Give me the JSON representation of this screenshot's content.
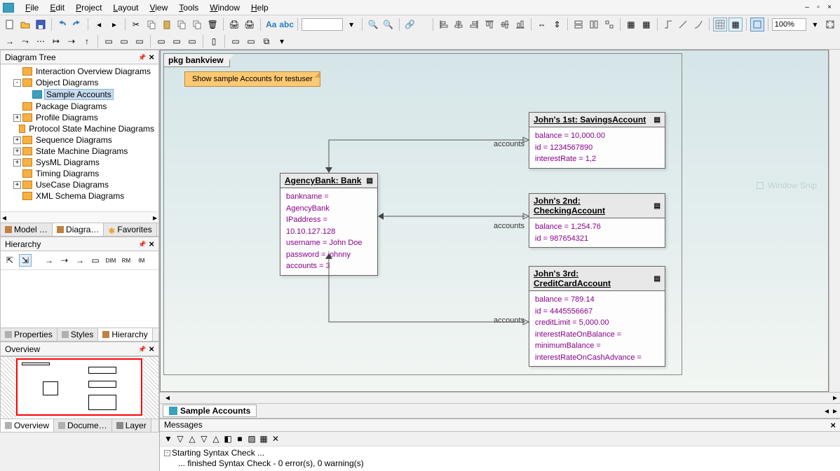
{
  "menu": {
    "items": [
      "File",
      "Edit",
      "Project",
      "Layout",
      "View",
      "Tools",
      "Window",
      "Help"
    ]
  },
  "zoom": "100%",
  "tree": {
    "title": "Diagram Tree",
    "items": [
      {
        "indent": 1,
        "exp": "",
        "label": "Interaction Overview Diagrams"
      },
      {
        "indent": 1,
        "exp": "-",
        "label": "Object Diagrams"
      },
      {
        "indent": 2,
        "exp": "",
        "label": "Sample Accounts",
        "icon": "blue",
        "selected": true
      },
      {
        "indent": 1,
        "exp": "",
        "label": "Package Diagrams"
      },
      {
        "indent": 1,
        "exp": "+",
        "label": "Profile Diagrams"
      },
      {
        "indent": 1,
        "exp": "",
        "label": "Protocol State Machine Diagrams"
      },
      {
        "indent": 1,
        "exp": "+",
        "label": "Sequence Diagrams"
      },
      {
        "indent": 1,
        "exp": "+",
        "label": "State Machine Diagrams"
      },
      {
        "indent": 1,
        "exp": "+",
        "label": "SysML Diagrams"
      },
      {
        "indent": 1,
        "exp": "",
        "label": "Timing Diagrams"
      },
      {
        "indent": 1,
        "exp": "+",
        "label": "UseCase Diagrams"
      },
      {
        "indent": 1,
        "exp": "",
        "label": "XML Schema Diagrams"
      }
    ],
    "tabs": [
      "Model …",
      "Diagra…",
      "Favorites"
    ]
  },
  "hierarchy": {
    "title": "Hierarchy",
    "tabs": [
      "Properties",
      "Styles",
      "Hierarchy"
    ]
  },
  "overview": {
    "title": "Overview",
    "tabs": [
      "Overview",
      "Docume…",
      "Layer"
    ]
  },
  "canvas": {
    "frameLabel": "pkg bankview",
    "note": "Show sample Accounts for testuser",
    "bank": {
      "title": "AgencyBank: Bank",
      "attrs": [
        "bankname =  AgencyBank",
        "IPaddress =  10.10.127.128",
        "username =  John Doe",
        "password =  johnny",
        "accounts =  3"
      ]
    },
    "savings": {
      "title": "John's 1st: SavingsAccount",
      "attrs": [
        "balance =  10,000.00",
        "id =  1234567890",
        "interestRate =  1,2"
      ]
    },
    "checking": {
      "title": "John's 2nd: CheckingAccount",
      "attrs": [
        "balance =  1,254.76",
        "id =  987654321"
      ]
    },
    "credit": {
      "title": "John's 3rd: CreditCardAccount",
      "attrs": [
        "balance =  789.14",
        "id =  4445556667",
        "creditLimit =  5,000.00",
        "interestRateOnBalance =",
        "minimumBalance =",
        "interestRateOnCashAdvance ="
      ]
    },
    "connLabels": [
      "accounts",
      "accounts",
      "accounts"
    ]
  },
  "docTab": "Sample Accounts",
  "messages": {
    "title": "Messages",
    "lines": [
      "Starting Syntax Check ...",
      "     ... finished Syntax Check - 0 error(s), 0 warning(s)"
    ]
  },
  "windowSnip": "Window Snip"
}
